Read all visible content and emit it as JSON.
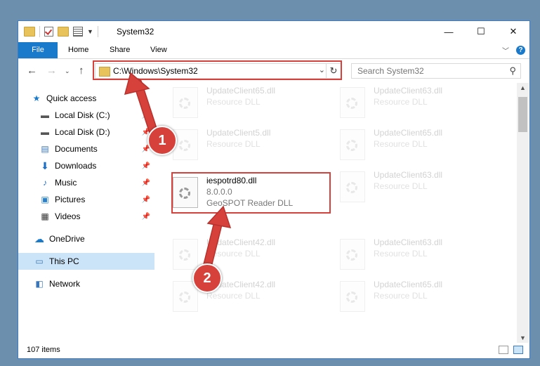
{
  "window": {
    "title": "System32",
    "controls": {
      "minimize": "—",
      "maximize": "☐",
      "close": "✕"
    }
  },
  "ribbon": {
    "tabs": [
      "File",
      "Home",
      "Share",
      "View"
    ]
  },
  "nav": {
    "address": "C:\\Windows\\System32",
    "search_placeholder": "Search System32"
  },
  "sidebar": {
    "items": [
      {
        "label": "Quick access",
        "icon": "star-icon",
        "pinned": false
      },
      {
        "label": "Local Disk (C:)",
        "icon": "drive-icon",
        "pinned": true
      },
      {
        "label": "Local Disk (D:)",
        "icon": "drive-icon",
        "pinned": true
      },
      {
        "label": "Documents",
        "icon": "documents-icon",
        "pinned": true
      },
      {
        "label": "Downloads",
        "icon": "downloads-icon",
        "pinned": true
      },
      {
        "label": "Music",
        "icon": "music-icon",
        "pinned": true
      },
      {
        "label": "Pictures",
        "icon": "pictures-icon",
        "pinned": true
      },
      {
        "label": "Videos",
        "icon": "videos-icon",
        "pinned": true
      },
      {
        "label": "OneDrive",
        "icon": "cloud-icon",
        "pinned": false
      },
      {
        "label": "This PC",
        "icon": "computer-icon",
        "pinned": false,
        "selected": true
      },
      {
        "label": "Network",
        "icon": "network-icon",
        "pinned": false
      }
    ]
  },
  "files": {
    "left_column": [
      {
        "name": "UpdateClient65.dll",
        "desc": "Resource DLL"
      },
      {
        "name": "UpdateClient5.dll",
        "desc": "Resource DLL"
      },
      {
        "name": "iespotrd80.dll",
        "version": "8.0.0.0",
        "desc": "GeoSPOT Reader DLL",
        "highlighted": true
      },
      {
        "name": "UpdateClient42.dll",
        "desc": "Resource DLL"
      },
      {
        "name": "UpdateClient42.dll",
        "desc": "Resource DLL"
      }
    ],
    "right_column": [
      {
        "name": "UpdateClient63.dll",
        "desc": "Resource DLL"
      },
      {
        "name": "UpdateClient65.dll",
        "desc": "Resource DLL"
      },
      {
        "name": "UpdateClient63.dll",
        "desc": "Resource DLL"
      },
      {
        "name": "UpdateClient63.dll",
        "desc": "Resource DLL"
      },
      {
        "name": "UpdateClient65.dll",
        "desc": "Resource DLL"
      }
    ]
  },
  "status": {
    "item_count": "107 items"
  },
  "annotations": {
    "step1": "1",
    "step2": "2",
    "color": "#d6413b"
  }
}
